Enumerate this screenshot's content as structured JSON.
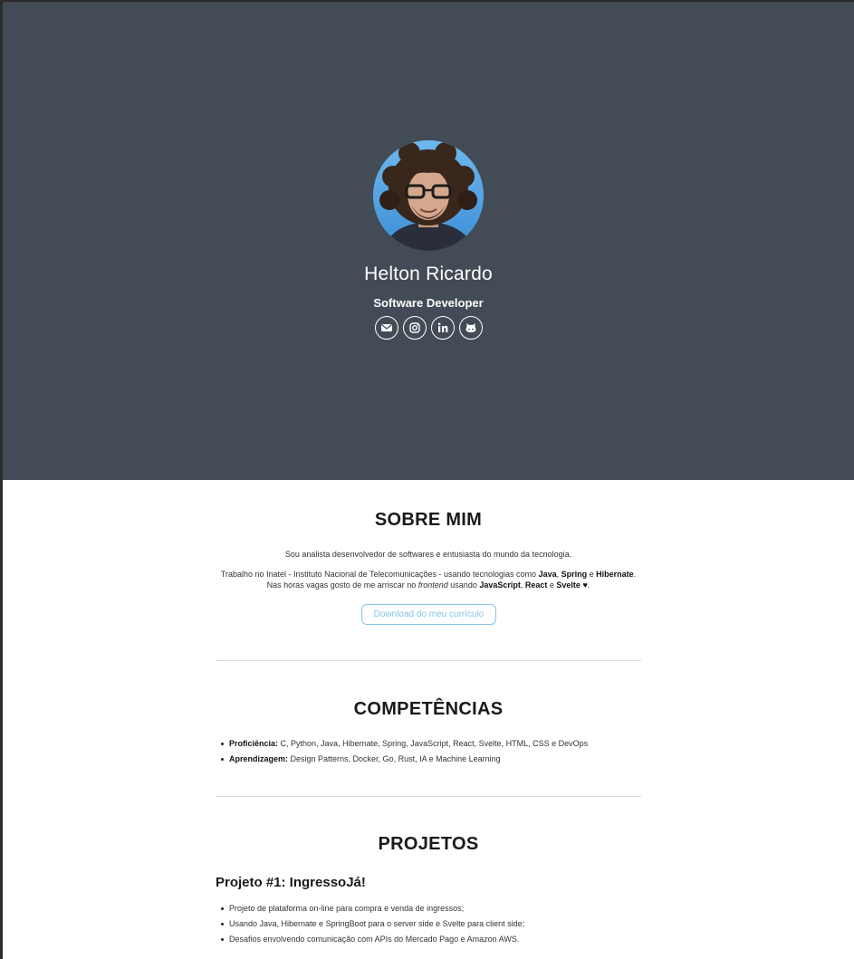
{
  "hero": {
    "name": "Helton Ricardo",
    "role": "Software Developer",
    "socials": [
      {
        "icon": "envelope-icon",
        "label": "email"
      },
      {
        "icon": "instagram-icon",
        "label": "instagram"
      },
      {
        "icon": "linkedin-icon",
        "label": "in"
      },
      {
        "icon": "github-icon",
        "label": "github"
      }
    ],
    "background_color": "#434b56"
  },
  "about": {
    "title": "SOBRE MIM",
    "line1": "Sou analista desenvolvedor de softwares e entusiasta do mundo da tecnologia.",
    "p2_part1": "Trabalho no Inatel - Instituto Nacional de Telecomunicações - usando tecnologias como ",
    "p2_java": "Java",
    "p2_sep1": ", ",
    "p2_spring": "Spring",
    "p2_sep2": " e ",
    "p2_hibernate": "Hibernate",
    "p2_part2": ". Nas horas vagas gosto de me arriscar no ",
    "p2_frontend": "frontend",
    "p2_part3": " usando ",
    "p2_js": "JavaScript",
    "p2_sep3": ", ",
    "p2_react": "React",
    "p2_sep4": " e ",
    "p2_svelte": "Svelte",
    "p2_heart": " ♥",
    "p2_end": ".",
    "cv_button": "Download do meu currículo",
    "accent_color": "#87c3ea"
  },
  "skills": {
    "title": "COMPETÊNCIAS",
    "items": [
      {
        "label": "Proficiência:",
        "value": " C, Python, Java, Hibernate, Spring, JavaScript, React, Svelte, HTML, CSS e DevOps"
      },
      {
        "label": "Aprendizagem:",
        "value": " Design Patterns, Docker, Go, Rust, IA e Machine Learning"
      }
    ]
  },
  "projects": {
    "title": "PROJETOS",
    "items": [
      {
        "title": "Projeto #1: IngressoJá!",
        "bullets": [
          "Projeto de plataforma on-line para compra e venda de ingressos;",
          "Usando Java, Hibernate e SpringBoot para o server side e Svelte para client side;",
          "Desafios envolvendo comunicação com APIs do Mercado Pago e Amazon AWS."
        ]
      }
    ]
  }
}
